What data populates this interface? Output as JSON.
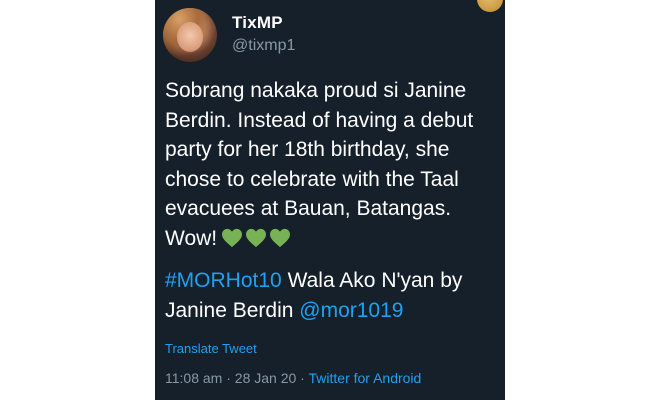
{
  "tweet": {
    "display_name": "TixMP",
    "handle": "@tixmp1",
    "text_lines": [
      "Sobrang nakaka proud si Janine",
      "Berdin. Instead of having a debut",
      "party for her 18th birthday, she",
      "chose to celebrate with the Taal",
      "evacuees at Bauan, Batangas."
    ],
    "last_line_text": "Wow!",
    "emoji": [
      "green-heart",
      "green-heart",
      "green-heart"
    ],
    "hashtag": "#MORHot10",
    "after_hashtag": "Wala Ako N'yan by",
    "song_artist": "Janine Berdin",
    "mention": "@mor1019",
    "translate_label": "Translate Tweet",
    "time": "11:08 am",
    "separator": " · ",
    "date": "28 Jan 20",
    "source": "Twitter for Android"
  },
  "colors": {
    "card_bg": "#15202b",
    "page_bg": "#ffffff",
    "link": "#1da1f2",
    "muted": "#8899a6",
    "heart": "#77b255"
  }
}
